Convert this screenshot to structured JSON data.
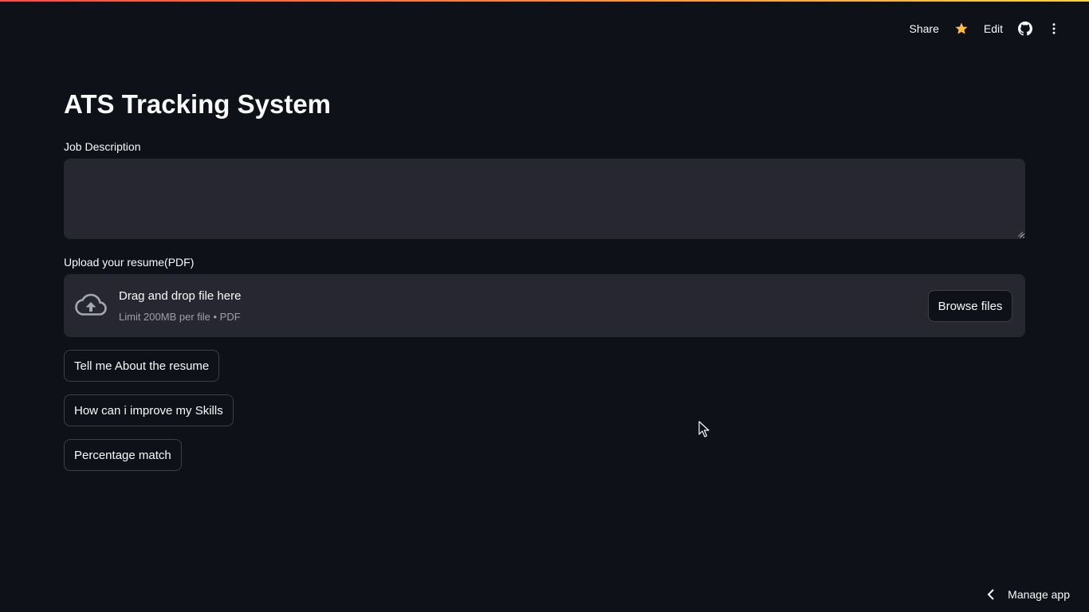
{
  "toolbar": {
    "share_label": "Share",
    "edit_label": "Edit",
    "star_color": "#ffbd45"
  },
  "page": {
    "title": "ATS Tracking System"
  },
  "job_description": {
    "label": "Job Description",
    "value": "",
    "placeholder": ""
  },
  "uploader": {
    "label": "Upload your resume(PDF)",
    "drop_text": "Drag and drop file here",
    "limit_text": "Limit 200MB per file • PDF",
    "browse_label": "Browse files"
  },
  "actions": [
    {
      "label": "Tell me About the resume"
    },
    {
      "label": "How can i improve my Skills"
    },
    {
      "label": "Percentage match"
    }
  ],
  "footer": {
    "manage_label": "Manage app"
  },
  "colors": {
    "background": "#0e1117",
    "surface": "#262730",
    "border": "#3d3f47",
    "text": "#fafafa",
    "muted": "#9da0a6"
  }
}
